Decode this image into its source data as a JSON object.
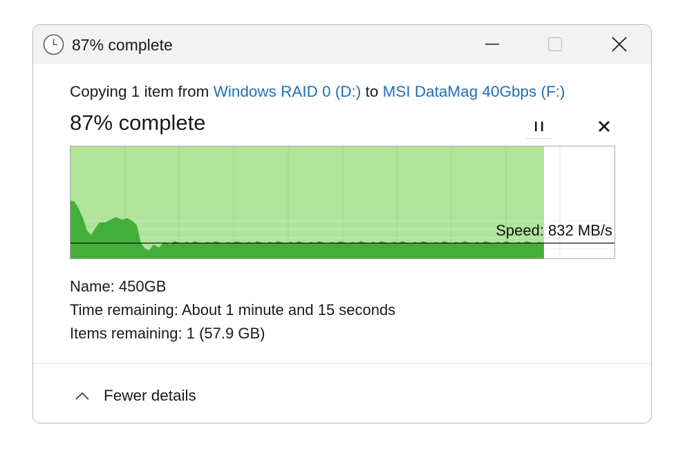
{
  "window": {
    "title": "87% complete",
    "icons": {
      "app": "clock-icon",
      "minimize": "minimize-icon",
      "maximize": "maximize-icon",
      "close": "close-icon"
    }
  },
  "copy": {
    "prefix": "Copying 1 item from ",
    "source": "Windows RAID 0 (D:)",
    "middle": " to ",
    "destination": "MSI DataMag 40Gbps (F:)",
    "link_color": "#1f6fb5"
  },
  "status": {
    "heading": "87% complete",
    "progress_percent": 87,
    "pause_icon": "pause-icon",
    "cancel_icon": "cancel-icon"
  },
  "graph": {
    "speed_label": "Speed: 832 MB/s",
    "current_speed": 832,
    "fill_color": "#b0e49c",
    "speed_area_color": "#44ae3a"
  },
  "details": {
    "name_label": "Name:",
    "name_value": "450GB",
    "time_label": "Time remaining:",
    "time_value": "About 1 minute and 15 seconds",
    "items_label": "Items remaining:",
    "items_value": "1 (57.9 GB)"
  },
  "footer": {
    "toggle_label": "Fewer details",
    "toggle_icon": "chevron-up-icon"
  }
}
